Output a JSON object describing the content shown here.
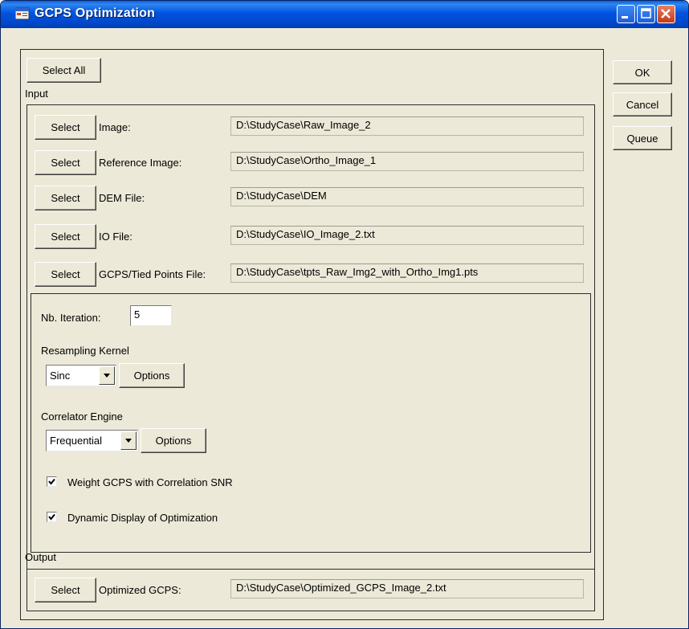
{
  "window": {
    "title": "GCPS Optimization"
  },
  "actions": {
    "select_all": "Select All",
    "ok": "OK",
    "cancel": "Cancel",
    "queue": "Queue"
  },
  "input": {
    "section_label": "Input",
    "rows": [
      {
        "button": "Select",
        "label": "Image:",
        "value": "D:\\StudyCase\\Raw_Image_2"
      },
      {
        "button": "Select",
        "label": "Reference Image:",
        "value": "D:\\StudyCase\\Ortho_Image_1"
      },
      {
        "button": "Select",
        "label": "DEM File:",
        "value": "D:\\StudyCase\\DEM"
      },
      {
        "button": "Select",
        "label": "IO File:",
        "value": "D:\\StudyCase\\IO_Image_2.txt"
      },
      {
        "button": "Select",
        "label": "GCPS/Tied Points File:",
        "value": "D:\\StudyCase\\tpts_Raw_Img2_with_Ortho_Img1.pts"
      }
    ]
  },
  "params": {
    "iterations_label": "Nb. Iteration:",
    "iterations_value": "5",
    "resampling_label": "Resampling Kernel",
    "resampling_value": "Sinc",
    "resampling_options": "Options",
    "correlator_label": "Correlator Engine",
    "correlator_value": "Frequential",
    "correlator_options": "Options",
    "weight_label": "Weight GCPS with Correlation SNR",
    "weight_checked": true,
    "dynamic_label": "Dynamic Display of Optimization",
    "dynamic_checked": true
  },
  "output": {
    "section_label": "Output",
    "button": "Select",
    "label": "Optimized GCPS:",
    "value": "D:\\StudyCase\\Optimized_GCPS_Image_2.txt"
  },
  "icons": {
    "app": "app-window-icon",
    "minimize": "minimize-icon",
    "maximize": "maximize-icon",
    "close": "close-icon"
  },
  "colors": {
    "titlebar": "#0053e0",
    "close": "#c5391b",
    "dialog": "#ece9d8"
  }
}
